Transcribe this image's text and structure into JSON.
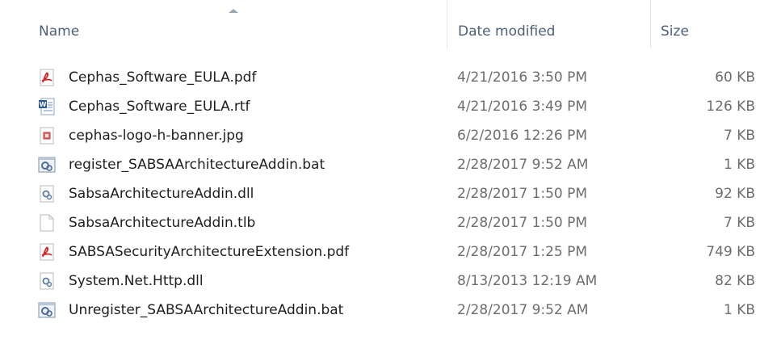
{
  "columns": {
    "name": "Name",
    "date_modified": "Date modified",
    "size": "Size"
  },
  "files": [
    {
      "name": "Cephas_Software_EULA.pdf",
      "date": "4/21/2016 3:50 PM",
      "size": "60 KB",
      "icon": "pdf-file-icon"
    },
    {
      "name": "Cephas_Software_EULA.rtf",
      "date": "4/21/2016 3:49 PM",
      "size": "126 KB",
      "icon": "word-document-icon"
    },
    {
      "name": "cephas-logo-h-banner.jpg",
      "date": "6/2/2016 12:26 PM",
      "size": "7 KB",
      "icon": "image-file-icon"
    },
    {
      "name": "register_SABSAArchitectureAddin.bat",
      "date": "2/28/2017 9:52 AM",
      "size": "1 KB",
      "icon": "batch-file-icon"
    },
    {
      "name": "SabsaArchitectureAddin.dll",
      "date": "2/28/2017 1:50 PM",
      "size": "92 KB",
      "icon": "dll-file-icon"
    },
    {
      "name": "SabsaArchitectureAddin.tlb",
      "date": "2/28/2017 1:50 PM",
      "size": "7 KB",
      "icon": "blank-file-icon"
    },
    {
      "name": "SABSASecurityArchitectureExtension.pdf",
      "date": "2/28/2017 1:25 PM",
      "size": "749 KB",
      "icon": "pdf-file-icon"
    },
    {
      "name": "System.Net.Http.dll",
      "date": "8/13/2013 12:19 AM",
      "size": "82 KB",
      "icon": "dll-file-icon"
    },
    {
      "name": "Unregister_SABSAArchitectureAddin.bat",
      "date": "2/28/2017 9:52 AM",
      "size": "1 KB",
      "icon": "batch-file-icon"
    }
  ]
}
